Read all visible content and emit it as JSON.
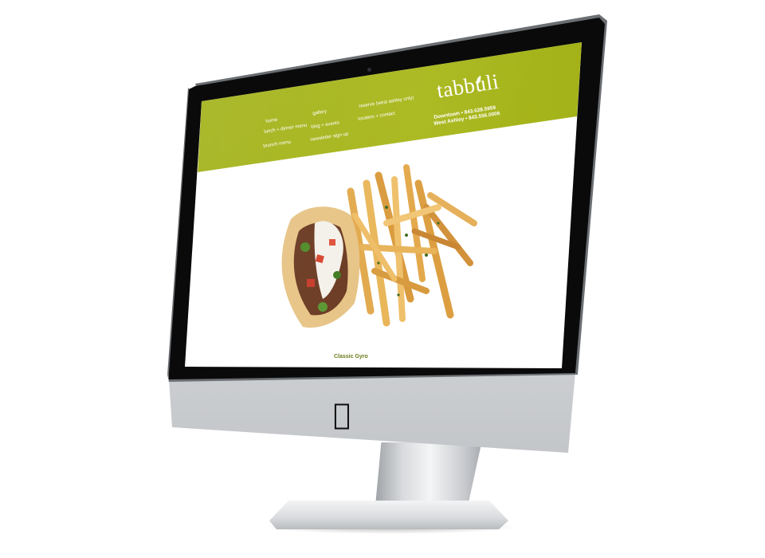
{
  "brand": "tabbuli",
  "locations": [
    "Downtown • 843.628.5959",
    "West Ashley • 843.556.0006"
  ],
  "nav": {
    "col1": [
      "home",
      "lunch + dinner menu",
      "brunch menu"
    ],
    "col2": [
      "gallery",
      "blog + events",
      "newsletter sign up"
    ],
    "col3": [
      "reserve (west ashley only)",
      "location + contact"
    ]
  },
  "caption": "Classic Gyro",
  "colors": {
    "header": "#a5b41a",
    "caption": "#6b7a1a",
    "screen_bg": "#ffffff",
    "bezel": "#0a0a0a"
  },
  "icons": {
    "apple": "apple-logo-icon",
    "camera": "webcam-icon"
  }
}
